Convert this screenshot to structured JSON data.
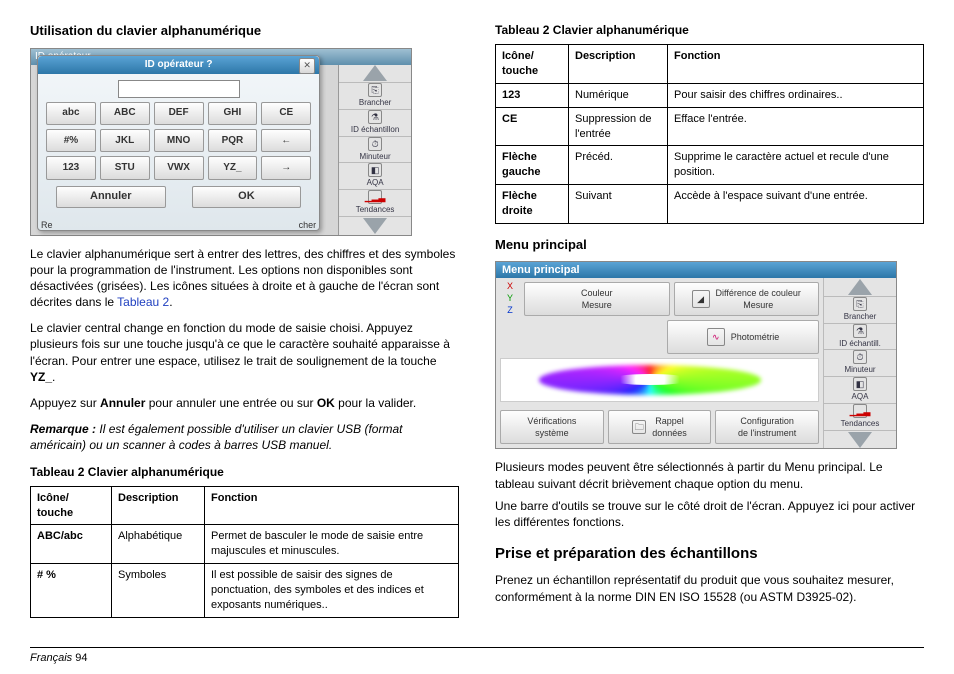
{
  "left": {
    "h1": "Utilisation du clavier alphanumérique",
    "p1a": "Le clavier alphanumérique sert à entrer des lettres, des chiffres et des symboles pour la programmation de l'instrument. Les options non disponibles sont désactivées (grisées). Les icônes situées à droite et à gauche de l'écran sont décrites dans le ",
    "p1link": "Tableau 2",
    "p1b": ".",
    "p2": "Le clavier central change en fonction du mode de saisie choisi. Appuyez plusieurs fois sur une touche jusqu'à ce que le caractère souhaité apparaisse à l'écran. Pour entrer une espace, utilisez le trait de soulignement de la touche ",
    "p2b": "YZ_",
    "p2c": ".",
    "p3a": "Appuyez sur ",
    "p3b": "Annuler",
    "p3c": " pour annuler une entrée ou sur ",
    "p3d": "OK",
    "p3e": " pour la valider.",
    "remark_label": "Remarque :",
    "remark_body": " Il est également possible d'utiliser un clavier USB (format américain) ou un scanner à codes à barres USB manuel.",
    "table_caption": "Tableau 2  Clavier alphanumérique",
    "table_headers": {
      "a": "Icône/ touche",
      "b": "Description",
      "c": "Fonction"
    },
    "table_rows": [
      {
        "a": "ABC/abc",
        "b": "Alphabétique",
        "c": "Permet de basculer le mode de saisie entre majuscules et minuscules."
      },
      {
        "a": "# %",
        "b": "Symboles",
        "c": "Il est possible de saisir des signes de ponctuation, des symboles et des indices et exposants numériques.."
      }
    ]
  },
  "kb": {
    "header_left": "ID opérateur",
    "dialog_title": "ID opérateur ?",
    "keys": [
      "abc",
      "ABC",
      "DEF",
      "GHI",
      "CE",
      "#%",
      "JKL",
      "MNO",
      "PQR",
      "←",
      "123",
      "STU",
      "VWX",
      "YZ_",
      "→"
    ],
    "cancel": "Annuler",
    "ok": "OK",
    "bottom_left": "Re",
    "bottom_right": "cher",
    "side": [
      "",
      "Brancher",
      "ID échantillon",
      "Minuteur",
      "AQA",
      "Tendances",
      ""
    ]
  },
  "right": {
    "table_caption": "Tableau 2  Clavier alphanumérique",
    "table_headers": {
      "a": "Icône/ touche",
      "b": "Description",
      "c": "Fonction"
    },
    "table_rows": [
      {
        "a": "123",
        "b": "Numérique",
        "c": "Pour saisir des chiffres ordinaires.."
      },
      {
        "a": "CE",
        "b": "Suppression de l'entrée",
        "c": "Efface l'entrée."
      },
      {
        "a": "Flèche gauche",
        "b": "Précéd.",
        "c": "Supprime le caractère actuel et recule d'une position."
      },
      {
        "a": "Flèche droite",
        "b": "Suivant",
        "c": "Accède à l'espace suivant d'une entrée."
      }
    ],
    "menu_title": "Menu principal",
    "p1": "Plusieurs modes peuvent être sélectionnés à partir du Menu principal. Le tableau suivant décrit brièvement chaque option du menu.",
    "p2": "Une barre d'outils se trouve sur le côté droit de l'écran. Appuyez ici pour activer les différentes fonctions.",
    "h2": "Prise et préparation des échantillons",
    "p3": "Prenez un échantillon représentatif du produit que vous souhaitez mesurer, conformément à la norme DIN EN ISO 15528 (ou ASTM D3925-02)."
  },
  "mm": {
    "title": "Menu principal",
    "xyz": [
      "X",
      "Y",
      "Z"
    ],
    "top1a": "Couleur",
    "top1b": "Mesure",
    "top2a": "Différence de couleur",
    "top2b": "Mesure",
    "top3": "Photométrie",
    "bot1a": "Vérifications",
    "bot1b": "système",
    "bot2a": "Rappel",
    "bot2b": "données",
    "bot3a": "Configuration",
    "bot3b": "de l'instrument",
    "side": [
      "",
      "Brancher",
      "ID échantill.",
      "Minuteur",
      "AQA",
      "Tendances",
      ""
    ]
  },
  "footer": {
    "lang": "Français",
    "page": "94"
  }
}
